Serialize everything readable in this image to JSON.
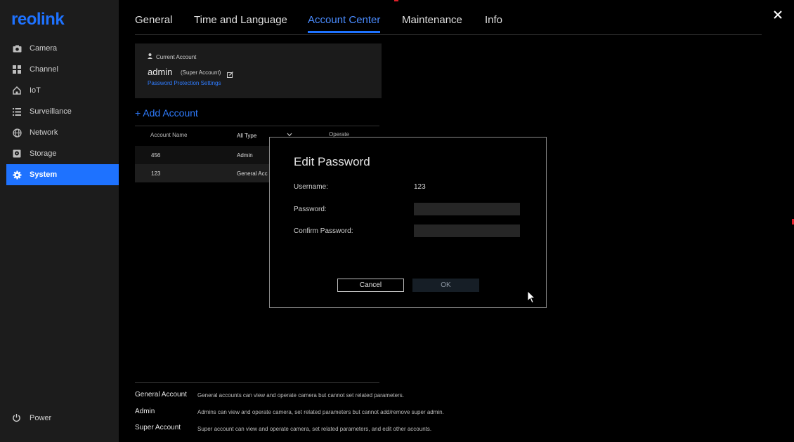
{
  "app": {
    "logo": "reolink"
  },
  "sidebar": {
    "items": [
      {
        "label": "Camera"
      },
      {
        "label": "Channel"
      },
      {
        "label": "IoT"
      },
      {
        "label": "Surveillance"
      },
      {
        "label": "Network"
      },
      {
        "label": "Storage"
      },
      {
        "label": "System"
      }
    ],
    "active": "System",
    "power_label": "Power"
  },
  "tabs": [
    {
      "label": "General"
    },
    {
      "label": "Time and Language"
    },
    {
      "label": "Account Center"
    },
    {
      "label": "Maintenance"
    },
    {
      "label": "Info"
    }
  ],
  "active_tab": "Account Center",
  "current_account": {
    "heading": "Current Account",
    "name": "admin",
    "role": "(Super Account)",
    "link": "Password Protection Settings"
  },
  "add_account_label": "+ Add Account",
  "table": {
    "headers": {
      "name": "Account Name",
      "type": "All Type",
      "operate": "Operate"
    },
    "rows": [
      {
        "name": "456",
        "type": "Admin"
      },
      {
        "name": "123",
        "type": "General Acc"
      }
    ]
  },
  "legend": [
    {
      "term": "General Account",
      "desc": "General accounts can view and operate camera but cannot set related parameters."
    },
    {
      "term": "Admin",
      "desc": "Admins can view and operate camera, set related parameters but cannot add/remove super admin."
    },
    {
      "term": "Super Account",
      "desc": "Super account can view and operate camera, set related parameters, and edit other accounts."
    }
  ],
  "dialog": {
    "title": "Edit Password",
    "username_label": "Username:",
    "username_value": "123",
    "password_label": "Password:",
    "password_value": "",
    "confirm_label": "Confirm Password:",
    "confirm_value": "",
    "cancel_label": "Cancel",
    "ok_label": "OK"
  },
  "colors": {
    "accent": "#1e72ff",
    "sidebar_bg": "#1c1c1c",
    "background": "#000000"
  }
}
